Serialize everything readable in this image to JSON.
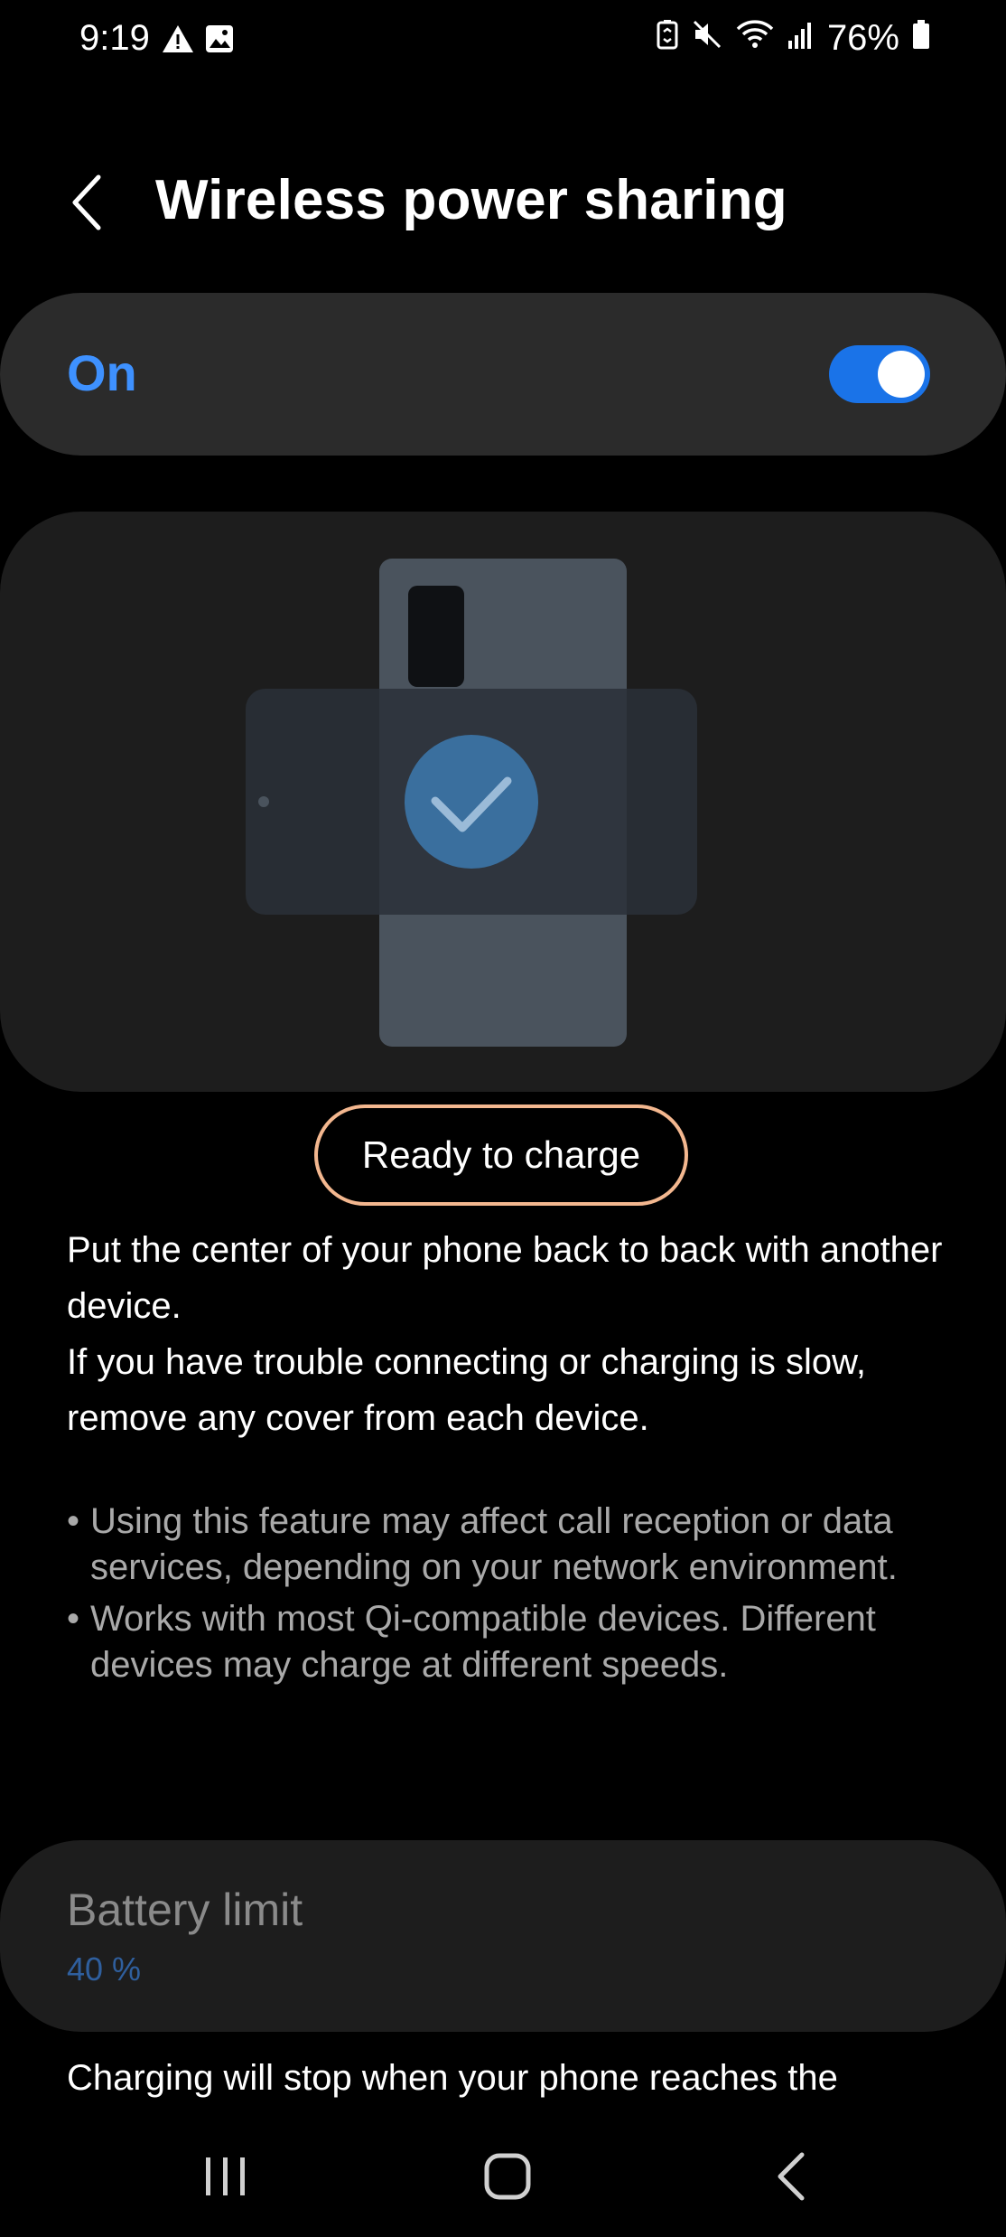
{
  "status_bar": {
    "time": "9:19",
    "left_icons": [
      "warning-icon",
      "image-icon"
    ],
    "right_icons": [
      "battery-share-icon",
      "mute-icon",
      "wifi-icon",
      "signal-icon"
    ],
    "battery_percent": "76%"
  },
  "header": {
    "back_icon": "back-chevron-icon",
    "title": "Wireless power sharing"
  },
  "master_switch": {
    "label": "On",
    "enabled": true
  },
  "illustration": {
    "icons": [
      "phone-illustration",
      "check-icon"
    ]
  },
  "status_pill": {
    "label": "Ready to charge",
    "border_color": "#f3b78f"
  },
  "description": {
    "line1": "Put the center of your phone back to back with another device.",
    "line2": "If you have trouble connecting or charging is slow, remove any cover from each device."
  },
  "notes": [
    "Using this feature may affect call reception or data services, depending on your network environment.",
    "Works with most Qi-compatible devices. Different devices may charge at different speeds."
  ],
  "battery_limit": {
    "title": "Battery limit",
    "value": "40 %"
  },
  "footer_text": "Charging will stop when your phone reaches the",
  "nav_bar": {
    "items": [
      "recents-icon",
      "home-icon",
      "back-icon"
    ]
  },
  "colors": {
    "accent": "#3e91ff",
    "toggle": "#1a73e8",
    "card": "#2b2b2b",
    "illus_card": "#1d1d1d"
  }
}
